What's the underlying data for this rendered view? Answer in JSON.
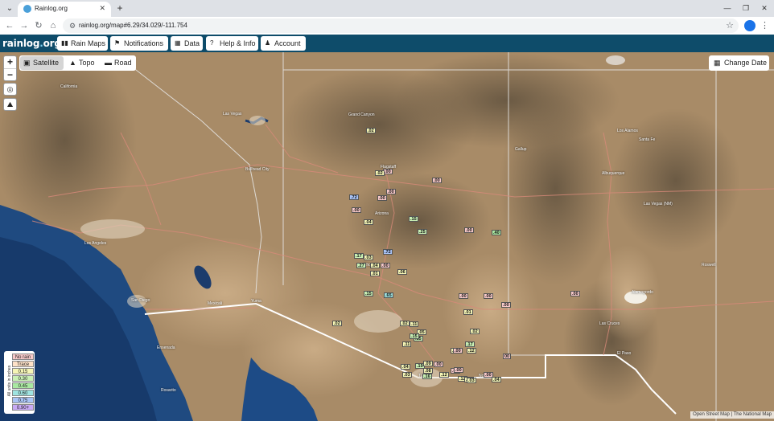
{
  "browser": {
    "tab_title": "Rainlog.org",
    "tab_close": "✕",
    "new_tab": "+",
    "url": "rainlog.org/map#6.29/34.029/-111.754",
    "tab_menu_icon": "⌄",
    "back_icon": "←",
    "forward_icon": "→",
    "reload_icon": "↻",
    "home_icon": "⌂",
    "site_info_icon": "⚙",
    "star_icon": "☆",
    "kebab_icon": "⋮",
    "minimize": "—",
    "restore": "❐",
    "close": "✕"
  },
  "site": {
    "logo_main": "rainlog",
    "logo_dot": ".",
    "logo_tld": "org",
    "nav": [
      {
        "label": "Rain Maps",
        "icon": "▮▮"
      },
      {
        "label": "Notifications",
        "icon": "⚑"
      },
      {
        "label": "Data",
        "icon": "▦"
      },
      {
        "label": "Help & Info",
        "icon": "?"
      },
      {
        "label": "Account",
        "icon": "♟"
      }
    ]
  },
  "map": {
    "zoom_in": "+",
    "zoom_out": "−",
    "locate_icon": "◎",
    "terrain_icon": "⛰",
    "layers": [
      {
        "label": "Satellite",
        "icon": "▣",
        "active": true
      },
      {
        "label": "Topo",
        "icon": "▲",
        "active": false
      },
      {
        "label": "Road",
        "icon": "▬",
        "active": false
      }
    ],
    "change_date_label": "Change Date",
    "change_date_icon": "▦",
    "attribution": "Open Street Map | The National Map",
    "legend": {
      "units": "All units in inches",
      "rows": [
        {
          "label": "No rain",
          "color": "#f7c9c9"
        },
        {
          "label": "Trace",
          "color": "#fde1c7"
        },
        {
          "label": "0.15",
          "color": "#f5f5b5"
        },
        {
          "label": "0.30",
          "color": "#c9f0b4"
        },
        {
          "label": "0.45",
          "color": "#a9e8a1"
        },
        {
          "label": "0.60",
          "color": "#9fe3e0"
        },
        {
          "label": "0.75",
          "color": "#a9c3f5"
        },
        {
          "label": "0.90+",
          "color": "#c8a9f5"
        }
      ]
    },
    "places": [
      "California",
      "Las Vegas",
      "Bullhead City",
      "Flagstaff",
      "Arizona",
      "Phoenix",
      "Los Angeles",
      "San Diego",
      "Tucson",
      "Albuquerque",
      "Santa Fe",
      "Los Alamos",
      "El Paso",
      "Las Cruces",
      "Ensenada",
      "Mexicali",
      "Yuma",
      "Grand Canyon",
      "Gallup",
      "Las Vegas (NM)",
      "Roswell",
      "Alamogordo",
      "Nogales",
      "Rosarito"
    ],
    "markers": [
      {
        "v": ".02",
        "c": "#f5f5b5"
      },
      {
        "v": ".00",
        "c": "#f7c9c9"
      },
      {
        "v": ".00",
        "c": "#f7c9c9"
      },
      {
        "v": ".15",
        "c": "#c9f0b4"
      },
      {
        "v": ".25",
        "c": "#c9f0b4"
      },
      {
        "v": ".00",
        "c": "#f7c9c9"
      },
      {
        "v": ".40",
        "c": "#a9e8a1"
      },
      {
        "v": ".04",
        "c": "#f5f5b5"
      },
      {
        "v": ".00",
        "c": "#f7c9c9"
      },
      {
        "v": ".02",
        "c": "#f5f5b5"
      },
      {
        "v": ".00",
        "c": "#f7c9c9"
      },
      {
        "v": ".01",
        "c": "#f5f5b5"
      },
      {
        "v": ".00",
        "c": "#f7c9c9"
      },
      {
        "v": ".00",
        "c": "#f7c9c9"
      },
      {
        "v": ".15",
        "c": "#c9f0b4"
      },
      {
        "v": ".65",
        "c": "#9fe3e0"
      },
      {
        "v": ".02",
        "c": "#f5f5b5"
      },
      {
        "v": ".02",
        "c": "#f5f5b5"
      },
      {
        "v": ".17",
        "c": "#c9f0b4"
      },
      {
        "v": ".12",
        "c": "#f5f5b5"
      },
      {
        "v": ".04",
        "c": "#f5f5b5"
      },
      {
        "v": ".00",
        "c": "#f7c9c9"
      },
      {
        "v": ".16",
        "c": "#c9f0b4"
      },
      {
        "v": ".03",
        "c": "#f5f5b5"
      },
      {
        "v": ".72",
        "c": "#a9c3f5"
      },
      {
        "v": ".03",
        "c": "#f5f5b5"
      },
      {
        "v": ".27",
        "c": "#c9f0b4"
      },
      {
        "v": ".04",
        "c": "#f5f5b5"
      },
      {
        "v": ".01",
        "c": "#f5f5b5"
      },
      {
        "v": ".06",
        "c": "#f5f5b5"
      },
      {
        "v": ".11",
        "c": "#f5f5b5"
      },
      {
        "v": ".15",
        "c": "#c9f0b4"
      },
      {
        "v": ".04",
        "c": "#f5f5b5"
      },
      {
        "v": ".19",
        "c": "#c9f0b4"
      },
      {
        "v": ".08",
        "c": "#f5f5b5"
      },
      {
        "v": ".00",
        "c": "#f7c9c9"
      },
      {
        "v": ".72",
        "c": "#a9c3f5"
      },
      {
        "v": ".00",
        "c": "#f7c9c9"
      },
      {
        "v": ".17",
        "c": "#c9f0b4"
      },
      {
        "v": ".00",
        "c": "#f7c9c9"
      },
      {
        "v": ".12",
        "c": "#f5f5b5"
      },
      {
        "v": ".00",
        "c": "#f7c9c9"
      },
      {
        "v": ".12",
        "c": "#f5f5b5"
      },
      {
        "v": ".00",
        "c": "#f7c9c9"
      },
      {
        "v": ".06",
        "c": "#f5f5b5"
      },
      {
        "v": ".00",
        "c": "#f7c9c9"
      },
      {
        "v": ".04",
        "c": "#f5f5b5"
      },
      {
        "v": ".03",
        "c": "#f5f5b5"
      },
      {
        "v": ".00",
        "c": "#f7c9c9"
      },
      {
        "v": "00",
        "c": "#f7c9c9"
      },
      {
        "v": ".02",
        "c": "#f5f5b5"
      },
      {
        "v": ".00",
        "c": "#f7c9c9"
      },
      {
        "v": ".11",
        "c": "#f5f5b5"
      },
      {
        "v": ".05",
        "c": "#f5f5b5"
      },
      {
        "v": ".15",
        "c": "#c9f0b4"
      },
      {
        "v": ".09",
        "c": "#f5f5b5"
      }
    ]
  }
}
